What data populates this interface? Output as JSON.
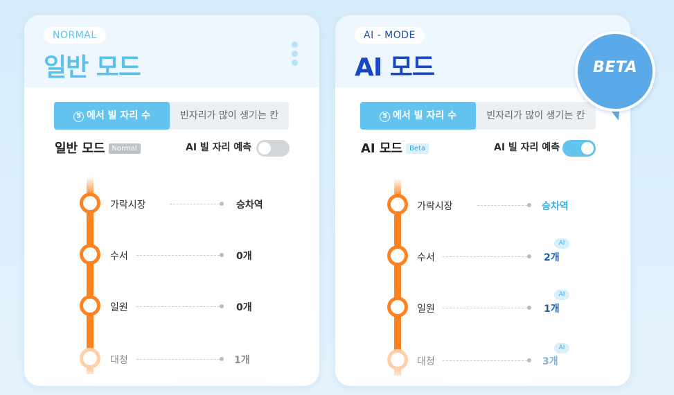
{
  "normal_card": {
    "mode_label": "NORMAL",
    "title": "일반 모드",
    "tabs": [
      {
        "num": "5",
        "label": "에서 빌 자리 수"
      },
      {
        "label": "빈자리가 많이 생기는 칸"
      }
    ],
    "sub_title": "일반 모드",
    "badge": "Normal",
    "predict_label": "AI 빌 자리 예측",
    "toggle_on": false,
    "stations": [
      {
        "name": "가락시장",
        "value": "승차역"
      },
      {
        "name": "수서",
        "value": "0개"
      },
      {
        "name": "일원",
        "value": "0개"
      },
      {
        "name": "대청",
        "value": "1개"
      }
    ]
  },
  "ai_card": {
    "mode_label": "AI - MODE",
    "title": "AI 모드",
    "tabs": [
      {
        "num": "5",
        "label": "에서 빌 자리 수"
      },
      {
        "label": "빈자리가 많이 생기는 칸"
      }
    ],
    "sub_title": "AI 모드",
    "badge": "Beta",
    "predict_label": "AI 빌 자리 예측",
    "toggle_on": true,
    "ai_tag": "AI",
    "stations": [
      {
        "name": "가락시장",
        "value": "승차역"
      },
      {
        "name": "수서",
        "value": "2개"
      },
      {
        "name": "일원",
        "value": "1개"
      },
      {
        "name": "대청",
        "value": "3개"
      }
    ]
  },
  "beta_bubble": {
    "label": "BETA"
  },
  "colors": {
    "accent_blue": "#62c3ef",
    "line_orange": "#ff8220",
    "ai_title_blue": "#1848c2",
    "bubble_blue": "#5aa9e8"
  }
}
